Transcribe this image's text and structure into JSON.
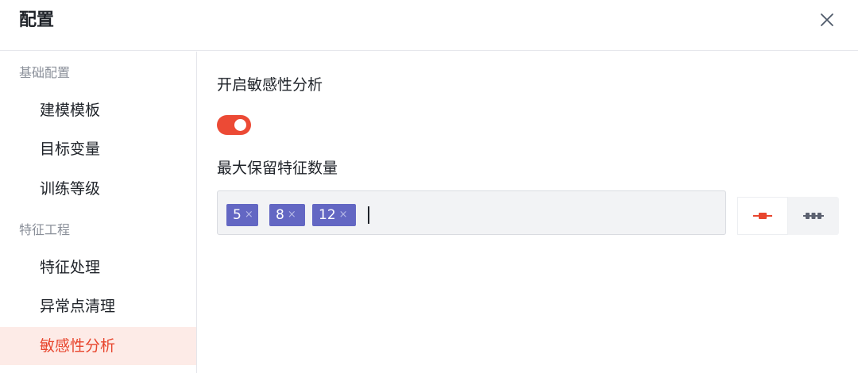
{
  "dialog": {
    "title": "配置",
    "close_icon": "close-icon"
  },
  "sidebar": {
    "groups": [
      {
        "label": "基础配置",
        "items": [
          "建模模板",
          "目标变量",
          "训练等级"
        ]
      },
      {
        "label": "特征工程",
        "items": [
          "特征处理",
          "异常点清理",
          "敏感性分析"
        ]
      }
    ],
    "active_item": "敏感性分析"
  },
  "main": {
    "sensitivity_label": "开启敏感性分析",
    "sensitivity_enabled": true,
    "max_features_label": "最大保留特征数量",
    "tags": [
      "5",
      "8",
      "12"
    ],
    "tag_remove_symbol": "×",
    "mode_options": [
      {
        "icon": "single-point-icon",
        "selected": true
      },
      {
        "icon": "multi-point-icon",
        "selected": false
      }
    ]
  },
  "colors": {
    "accent": "#e8462e",
    "switch_on": "#ec4a35",
    "tag_bg": "#6367c3",
    "active_bg": "#fdebe7",
    "input_bg": "#f2f3f5"
  }
}
